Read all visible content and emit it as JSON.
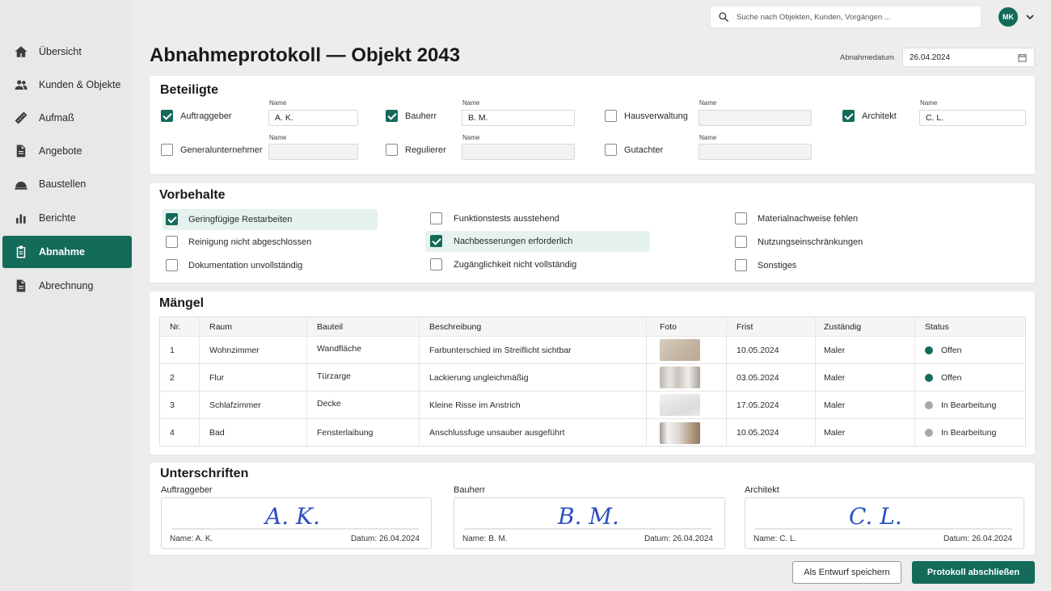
{
  "sidebar": {
    "items": [
      {
        "label": "Übersicht",
        "icon": "home-icon"
      },
      {
        "label": "Kunden & Objekte",
        "icon": "people-icon"
      },
      {
        "label": "Aufmaß",
        "icon": "ruler-icon"
      },
      {
        "label": "Angebote",
        "icon": "document-icon"
      },
      {
        "label": "Baustellen",
        "icon": "construction-icon"
      },
      {
        "label": "Berichte",
        "icon": "bar-chart-icon"
      },
      {
        "label": "Abnahme",
        "icon": "clipboard-icon",
        "active": true
      },
      {
        "label": "Abrechnung",
        "icon": "document-icon"
      }
    ]
  },
  "topbar": {
    "search_placeholder": "Suche nach Objekten, Kunden, Vorgängen ...",
    "avatar_initials": "MK"
  },
  "header": {
    "title": "Abnahmeprotokoll — Objekt 2043",
    "date_label": "Abnahmedatum",
    "date_value": "26.04.2024"
  },
  "beteiligte": {
    "title": "Beteiligte",
    "name_label": "Name",
    "parties": [
      {
        "role": "Auftraggeber",
        "checked": true,
        "name": "A. K."
      },
      {
        "role": "Bauherr",
        "checked": true,
        "name": "B. M."
      },
      {
        "role": "Hausverwaltung",
        "checked": false,
        "name": ""
      },
      {
        "role": "Architekt",
        "checked": true,
        "name": "C. L."
      },
      {
        "role": "Generalunternehmer",
        "checked": false,
        "name": ""
      },
      {
        "role": "Regulierer",
        "checked": false,
        "name": ""
      },
      {
        "role": "Gutachter",
        "checked": false,
        "name": ""
      }
    ]
  },
  "vorbehalte": {
    "title": "Vorbehalte",
    "items": [
      {
        "label": "Geringfügige Restarbeiten",
        "checked": true
      },
      {
        "label": "Reinigung nicht abgeschlossen",
        "checked": false
      },
      {
        "label": "Dokumentation unvollständig",
        "checked": false
      },
      {
        "label": "Funktionstests ausstehend",
        "checked": false
      },
      {
        "label": "Nachbesserungen erforderlich",
        "checked": true
      },
      {
        "label": "Zugänglichkeit nicht vollständig",
        "checked": false
      },
      {
        "label": "Materialnachweise fehlen",
        "checked": false
      },
      {
        "label": "Nutzungseinschränkungen",
        "checked": false
      },
      {
        "label": "Sonstiges",
        "checked": false
      }
    ]
  },
  "maengel": {
    "title": "Mängel",
    "columns": [
      "Nr.",
      "Raum",
      "Bauteil",
      "Beschreibung",
      "Foto",
      "Frist",
      "Zuständig",
      "Status"
    ],
    "rows": [
      {
        "nr": "1",
        "raum": "Wohnzimmer",
        "bauteil": "Wandfläche",
        "beschreibung": "Farbunterschied im Streiflicht sichtbar",
        "frist": "10.05.2024",
        "zustaendig": "Maler",
        "status": "Offen",
        "status_color": "#146b5a"
      },
      {
        "nr": "2",
        "raum": "Flur",
        "bauteil": "Türzarge",
        "beschreibung": "Lackierung ungleichmäßig",
        "frist": "03.05.2024",
        "zustaendig": "Maler",
        "status": "Offen",
        "status_color": "#146b5a"
      },
      {
        "nr": "3",
        "raum": "Schlafzimmer",
        "bauteil": "Decke",
        "beschreibung": "Kleine Risse im Anstrich",
        "frist": "17.05.2024",
        "zustaendig": "Maler",
        "status": "In Bearbeitung",
        "status_color": "#a8a8a8"
      },
      {
        "nr": "4",
        "raum": "Bad",
        "bauteil": "Fensterlaibung",
        "beschreibung": "Anschlussfuge unsauber ausgeführt",
        "frist": "10.05.2024",
        "zustaendig": "Maler",
        "status": "In Bearbeitung",
        "status_color": "#a8a8a8"
      }
    ]
  },
  "unterschriften": {
    "title": "Unterschriften",
    "signatures": [
      {
        "role": "Auftraggeber",
        "scribble": "A. K.",
        "name_line": "Name: A. K.",
        "date_line": "Datum: 26.04.2024"
      },
      {
        "role": "Bauherr",
        "scribble": "B. M.",
        "name_line": "Name: B. M.",
        "date_line": "Datum: 26.04.2024"
      },
      {
        "role": "Architekt",
        "scribble": "C. L.",
        "name_line": "Name: C. L.",
        "date_line": "Datum: 26.04.2024"
      }
    ]
  },
  "actions": {
    "draft_label": "Als Entwurf speichern",
    "finish_label": "Protokoll abschließen"
  },
  "colors": {
    "accent": "#146b5a",
    "signature_ink": "#2b4fc0"
  }
}
